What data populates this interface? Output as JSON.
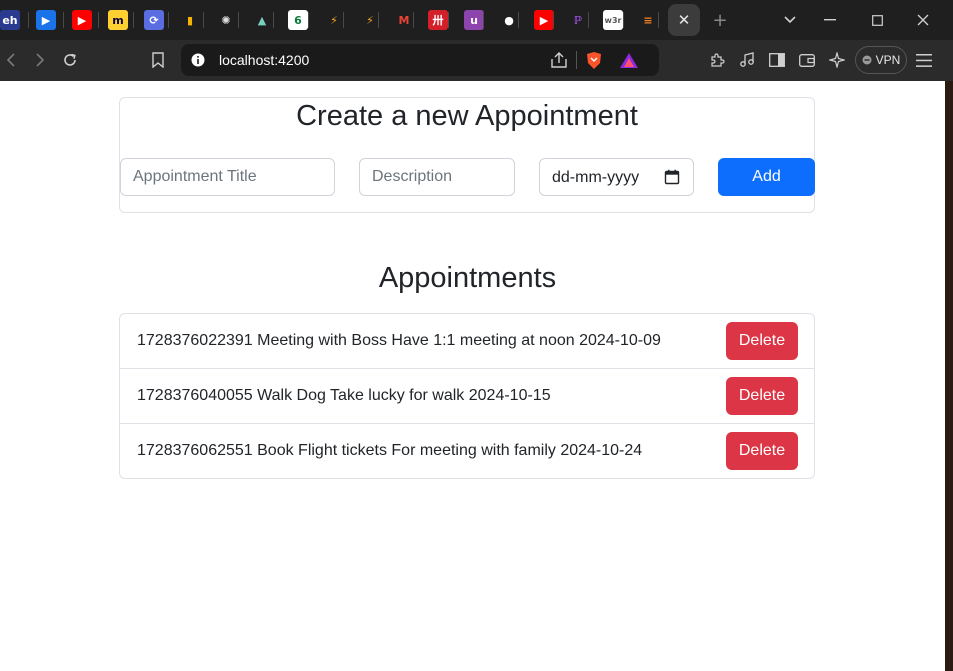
{
  "browser": {
    "tabs": [
      {
        "name": "eh-tab-icon",
        "glyph": "eh",
        "bg": "#2a3b8f",
        "color": "#ffffff"
      },
      {
        "name": "play-tab-icon",
        "glyph": "▶",
        "bg": "#1a73e8",
        "color": "#ffffff"
      },
      {
        "name": "youtube-tab-icon",
        "glyph": "▶",
        "bg": "#ff0000",
        "color": "#ffffff"
      },
      {
        "name": "miro-tab-icon",
        "glyph": "m",
        "bg": "#ffd02f",
        "color": "#050038"
      },
      {
        "name": "sync-tab-icon",
        "glyph": "⟳",
        "bg": "#5b6ee1",
        "color": "#ffffff"
      },
      {
        "name": "bar-chart-tab-icon",
        "glyph": "▮",
        "bg": "#1f1f1f",
        "color": "#f4b400"
      },
      {
        "name": "openai-tab-icon",
        "glyph": "✺",
        "bg": "#1f1f1f",
        "color": "#e0e0e0"
      },
      {
        "name": "mountain-tab-icon",
        "glyph": "▲",
        "bg": "#1f1f1f",
        "color": "#7ad0c0"
      },
      {
        "name": "leaf-tab-icon",
        "glyph": "6",
        "bg": "#ffffff",
        "color": "#0a7a3c"
      },
      {
        "name": "bolt-tab-icon",
        "glyph": "⚡",
        "bg": "#1f1f1f",
        "color": "#f5a623"
      },
      {
        "name": "bolt-tab-icon-2",
        "glyph": "⚡",
        "bg": "#1f1f1f",
        "color": "#f5a623"
      },
      {
        "name": "gmail-tab-icon",
        "glyph": "M",
        "bg": "#1f1f1f",
        "color": "#ea4335"
      },
      {
        "name": "red-app-tab-icon",
        "glyph": "卅",
        "bg": "#d21f2a",
        "color": "#ffffff"
      },
      {
        "name": "u-tab-icon",
        "glyph": "u",
        "bg": "#8e44ad",
        "color": "#ffffff"
      },
      {
        "name": "github-tab-icon",
        "glyph": "●",
        "bg": "#1f1f1f",
        "color": "#ffffff"
      },
      {
        "name": "youtube-tab-icon-2",
        "glyph": "▶",
        "bg": "#ff0000",
        "color": "#ffffff"
      },
      {
        "name": "pen-tab-icon",
        "glyph": "ℙ",
        "bg": "#1f1f1f",
        "color": "#a855f7"
      },
      {
        "name": "w3r-tab-icon",
        "glyph": "w3r",
        "bg": "#ffffff",
        "color": "#555555"
      },
      {
        "name": "stack-tab-icon",
        "glyph": "≡",
        "bg": "#1f1f1f",
        "color": "#f48024"
      }
    ],
    "close_tab_glyph": "✕",
    "new_tab_glyph": "+",
    "url": "localhost:4200",
    "vpn_label": "VPN"
  },
  "form": {
    "title": "Create a new Appointment",
    "title_placeholder": "Appointment Title",
    "description_placeholder": "Description",
    "date_placeholder": "dd-mm-yyyy",
    "add_label": "Add"
  },
  "list": {
    "title": "Appointments",
    "items": [
      {
        "text": "1728376022391 Meeting with Boss Have 1:1 meeting at noon 2024-10-09",
        "delete_label": "Delete"
      },
      {
        "text": "1728376040055 Walk Dog Take lucky for walk 2024-10-15",
        "delete_label": "Delete"
      },
      {
        "text": "1728376062551 Book Flight tickets For meeting with family 2024-10-24",
        "delete_label": "Delete"
      }
    ]
  },
  "colors": {
    "primary": "#0d6efd",
    "danger": "#dc3545",
    "border": "#dee2e6"
  }
}
